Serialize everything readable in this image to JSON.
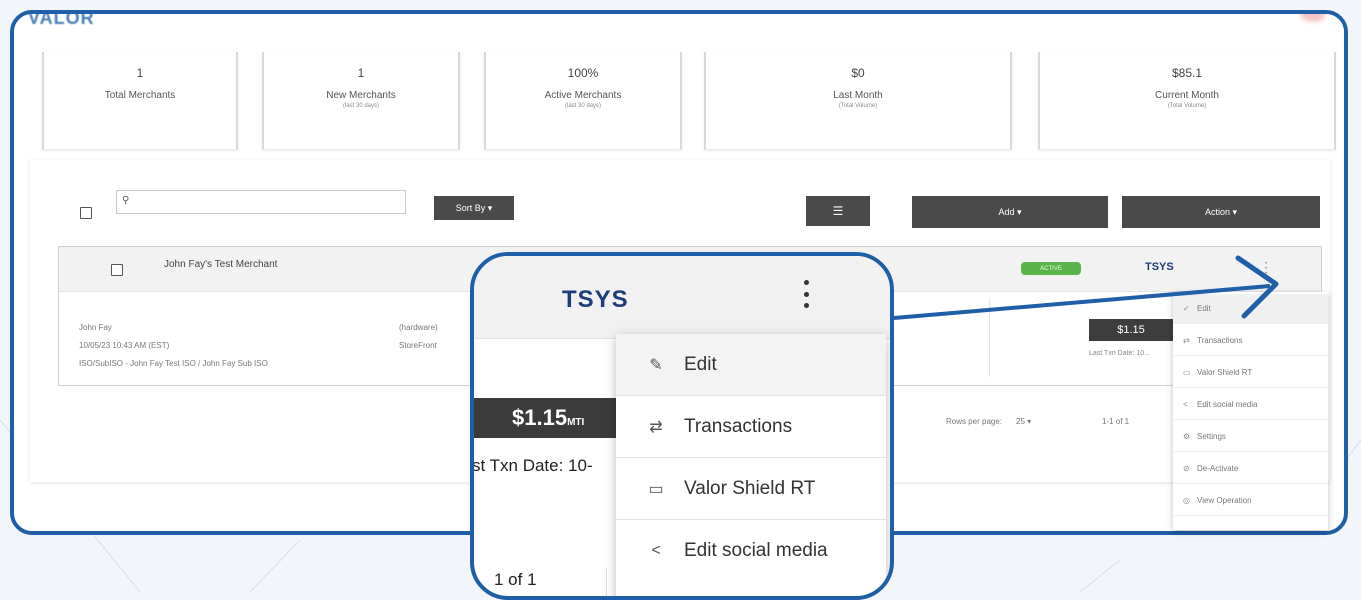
{
  "stats": [
    {
      "value": "1",
      "label": "Total Merchants",
      "sub": ""
    },
    {
      "value": "1",
      "label": "New Merchants",
      "sub": "(last 30 days)"
    },
    {
      "value": "100%",
      "label": "Active Merchants",
      "sub": "(last 30 days)"
    },
    {
      "value": "$0",
      "label": "Last Month",
      "sub": "(Total Volume)"
    },
    {
      "value": "$85.1",
      "label": "Current Month",
      "sub": "(Total Volume)"
    }
  ],
  "toolbar": {
    "search_icon": "search-icon",
    "sort_label": "Sort By ▾",
    "filter_icon": "filter-icon",
    "add_label": "Add ▾",
    "action_label": "Action ▾"
  },
  "merchant": {
    "name": "John Fay's Test Merchant",
    "owner": "John Fay",
    "date": "10/05/23 10:43 AM (EST)",
    "iso": "ISO/SubISO - John Fay Test ISO / John Fay Sub ISO",
    "col2_a": "(hardware)",
    "col2_b": "StoreFront",
    "status": "ACTIVE",
    "processor": "TSYS",
    "volume": "$1.15",
    "volume_unit": "MTD",
    "last_txn_sm": "Last Txn Date: 10..."
  },
  "pager": {
    "rows_label": "Rows per page:",
    "rows_value": "25 ▾",
    "range": "1-1 of 1"
  },
  "small_menu": [
    {
      "icon": "✓",
      "label": "Edit"
    },
    {
      "icon": "⇄",
      "label": "Transactions"
    },
    {
      "icon": "▭",
      "label": "Valor Shield RT"
    },
    {
      "icon": "<",
      "label": "Edit social media"
    },
    {
      "icon": "⚙",
      "label": "Settings"
    },
    {
      "icon": "⊘",
      "label": "De-Activate"
    },
    {
      "icon": "◎",
      "label": "View Operation"
    }
  ],
  "magnified": {
    "processor": "TSYS",
    "volume": "$1.15",
    "volume_unit": "MTI",
    "last_txn": "st Txn Date: 10-",
    "range": "1 of 1",
    "menu": [
      {
        "icon": "pencil-icon",
        "glyph": "✎",
        "label": "Edit"
      },
      {
        "icon": "transactions-icon",
        "glyph": "⇄",
        "label": "Transactions"
      },
      {
        "icon": "card-icon",
        "glyph": "▭",
        "label": "Valor Shield RT"
      },
      {
        "icon": "share-icon",
        "glyph": "<",
        "label": "Edit social media"
      }
    ]
  },
  "colors": {
    "frame": "#1e5fa8",
    "button": "#4a4a4a",
    "active_badge": "#5ab44a",
    "tsys": "#1e3c78"
  }
}
